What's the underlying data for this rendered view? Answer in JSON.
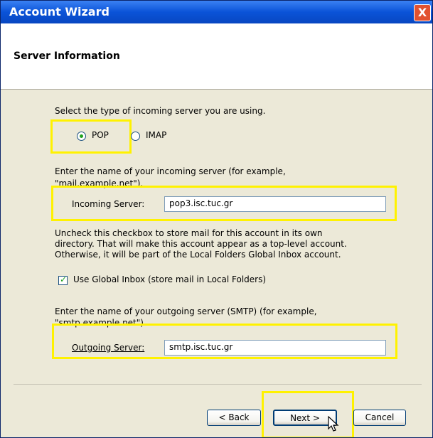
{
  "window": {
    "title": "Account Wizard",
    "close_label": "X"
  },
  "header": {
    "title": "Server Information"
  },
  "server_type": {
    "prompt": "Select the type of incoming server you are using.",
    "options": [
      {
        "label": "POP",
        "selected": true
      },
      {
        "label": "IMAP",
        "selected": false
      }
    ]
  },
  "incoming": {
    "prompt_line1": "Enter the name of your incoming server (for example,",
    "prompt_line2": "\"mail.example.net\").",
    "label": "Incoming Server:",
    "value": "pop3.isc.tuc.gr"
  },
  "global_inbox": {
    "description_lines": [
      "Uncheck this checkbox to store mail for this account in its own",
      "directory. That will make this account appear as a top-level account.",
      "Otherwise, it will be part of the Local Folders Global Inbox account."
    ],
    "checkbox_label": "Use Global Inbox (store mail in Local Folders)",
    "checked": true
  },
  "outgoing": {
    "prompt_line1": "Enter the name of your outgoing server (SMTP) (for example,",
    "prompt_line2": "\"smtp.example.net\").",
    "label": "Outgoing Server:",
    "value": "smtp.isc.tuc.gr"
  },
  "buttons": {
    "back": "< Back",
    "next": "Next >",
    "cancel": "Cancel"
  },
  "colors": {
    "highlight": "#FFF200",
    "titlebar": "#0A53D8",
    "dialog_bg": "#ECE9D8"
  }
}
